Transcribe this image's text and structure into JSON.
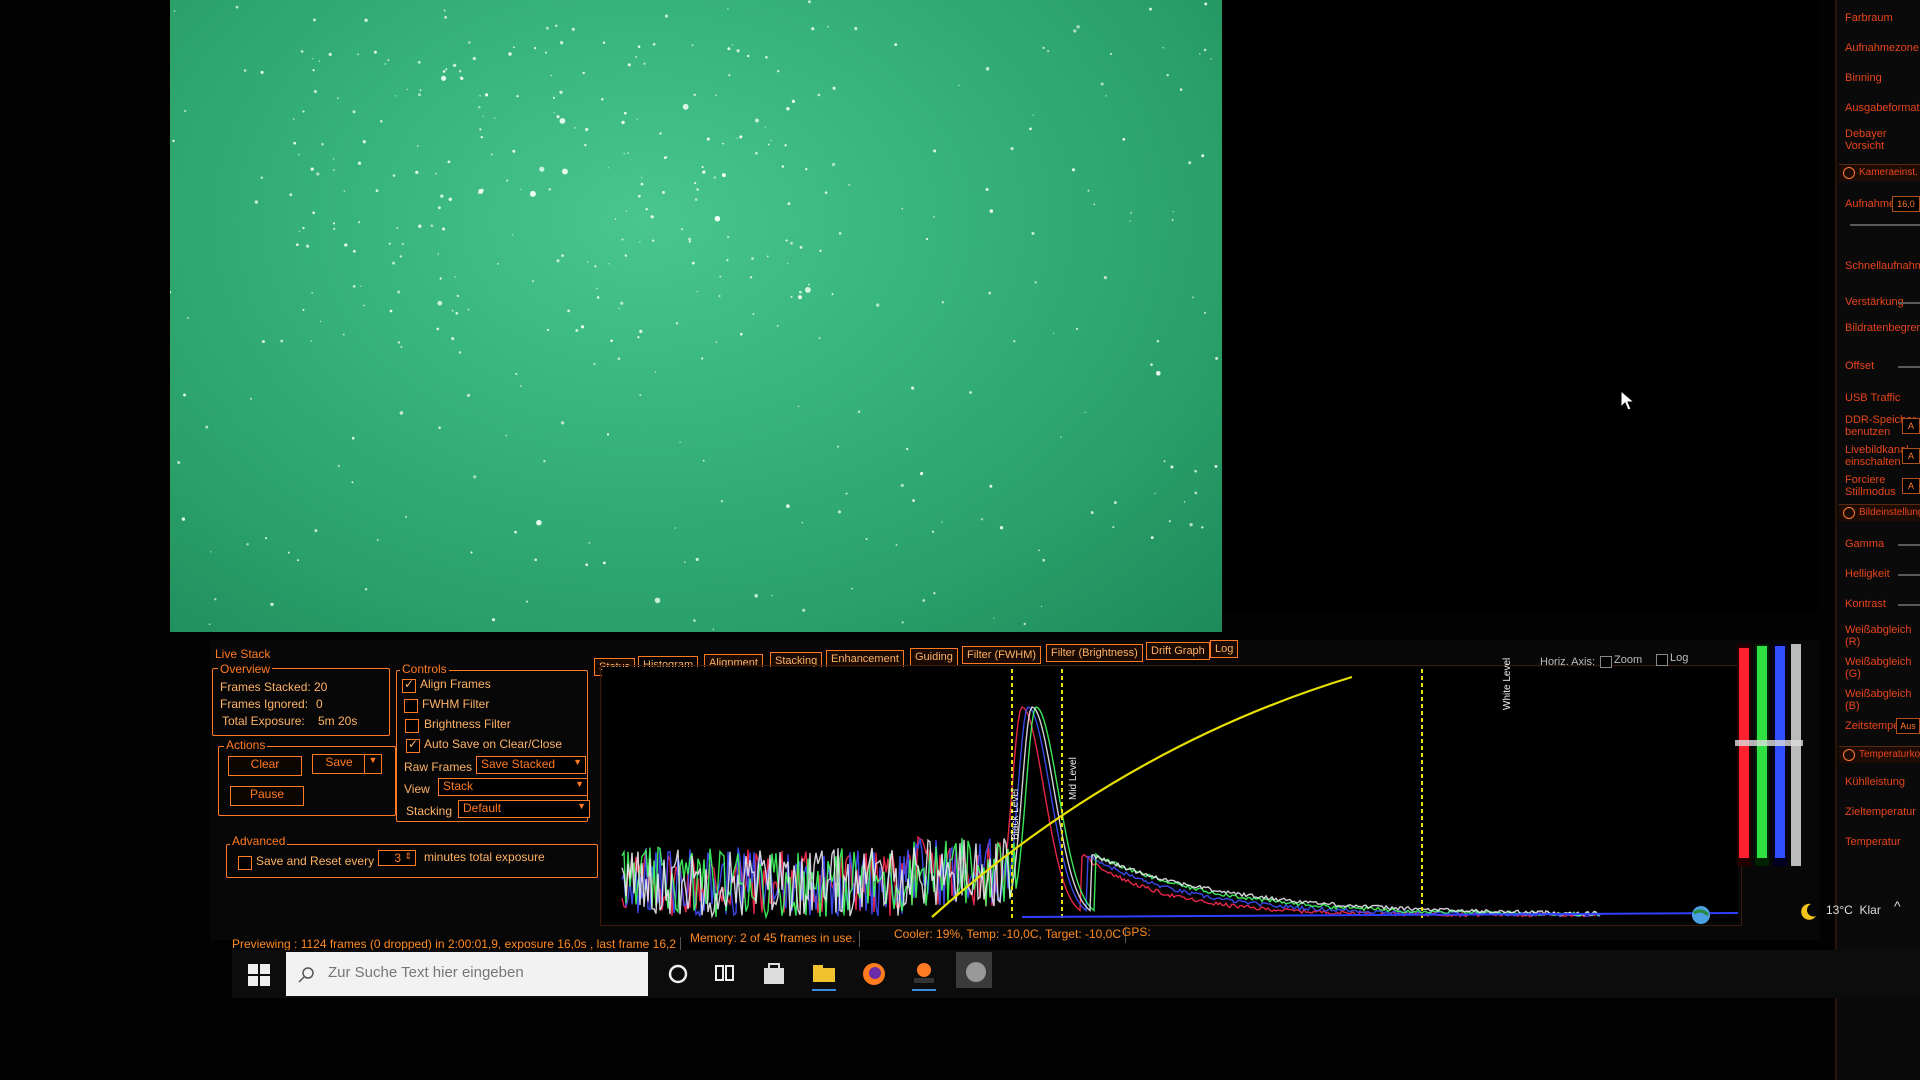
{
  "live_stack": {
    "title": "Live Stack",
    "overview": {
      "title": "Overview",
      "frames_stacked_label": "Frames Stacked:",
      "frames_stacked": "20",
      "frames_ignored_label": "Frames Ignored:",
      "frames_ignored": "0",
      "total_exposure_label": "Total Exposure:",
      "total_exposure": "5m 20s"
    },
    "actions": {
      "title": "Actions",
      "clear": "Clear",
      "save": "Save",
      "pause": "Pause"
    },
    "controls": {
      "title": "Controls",
      "align_frames": "Align Frames",
      "fwhm_filter": "FWHM Filter",
      "brightness_filter": "Brightness Filter",
      "auto_save": "Auto Save on Clear/Close",
      "raw_frames_label": "Raw Frames",
      "raw_frames_value": "Save Stacked",
      "view_label": "View",
      "view_value": "Stack",
      "stacking_label": "Stacking",
      "stacking_value": "Default"
    },
    "advanced": {
      "title": "Advanced",
      "save_reset_label": "Save and Reset every",
      "minutes_value": "3",
      "minutes_suffix": "minutes total exposure"
    }
  },
  "tabs": [
    {
      "label": "Status"
    },
    {
      "label": "Histogram"
    },
    {
      "label": "Alignment"
    },
    {
      "label": "Stacking"
    },
    {
      "label": "Enhancement"
    },
    {
      "label": "Guiding"
    },
    {
      "label": "Filter (FWHM)"
    },
    {
      "label": "Filter (Brightness)"
    },
    {
      "label": "Drift Graph"
    },
    {
      "label": "Log"
    }
  ],
  "histogram": {
    "horiz_axis_label": "Horiz. Axis:",
    "zoom_label": "Zoom",
    "log_label": "Log",
    "black_level_label": "Black Level",
    "mid_level_label": "Mid Level",
    "white_level_label": "White Level"
  },
  "status_bar": {
    "previewing": "Previewing : 1124 frames (0 dropped) in 2:00:01,9, exposure 16,0s , last frame 16,2",
    "memory": "Memory: 2 of 45 frames in use.",
    "cooler": "Cooler: 19%, Temp: -10,0C, Target: -10,0C",
    "gps": "GPS:"
  },
  "right_panel": {
    "items": [
      "Farbraum",
      "Aufnahmezone",
      "Binning",
      "Ausgabeformat",
      "Debayer Vorsicht"
    ],
    "section_camera": "Kameraeinst.",
    "camera_items": [
      "Aufnahme",
      "Schnellaufnahme",
      "Verstärkung",
      "Bildratenbegrenzung",
      "Offset",
      "USB Traffic",
      "DDR-Speicher benutzen",
      "Livebildkanal einschalten",
      "Forciere Stillmodus"
    ],
    "aufnahme_value": "16,0",
    "section_image": "Bildeinstellungen",
    "image_items": [
      "Gamma",
      "Helligkeit",
      "Kontrast",
      "Weißabgleich (R)",
      "Weißabgleich (G)",
      "Weißabgleich (B)",
      "Zeitstempel"
    ],
    "zeitstempel_value": "Aus",
    "section_temp": "Temperaturkontrolle",
    "temp_items": [
      "Kühlleistung",
      "Zieltemperatur",
      "Temperatur"
    ],
    "box_values": [
      "A",
      "A",
      "A"
    ]
  },
  "taskbar": {
    "search_placeholder": "Zur Suche Text hier eingeben",
    "temperature": "13°C",
    "weather": "Klar"
  },
  "colors": {
    "accent": "#ff7a22",
    "sky_green": "#37b47c",
    "hist_red": "#ff2244",
    "hist_green": "#33ff55",
    "hist_blue": "#3344ff",
    "curve": "#e8e000"
  }
}
